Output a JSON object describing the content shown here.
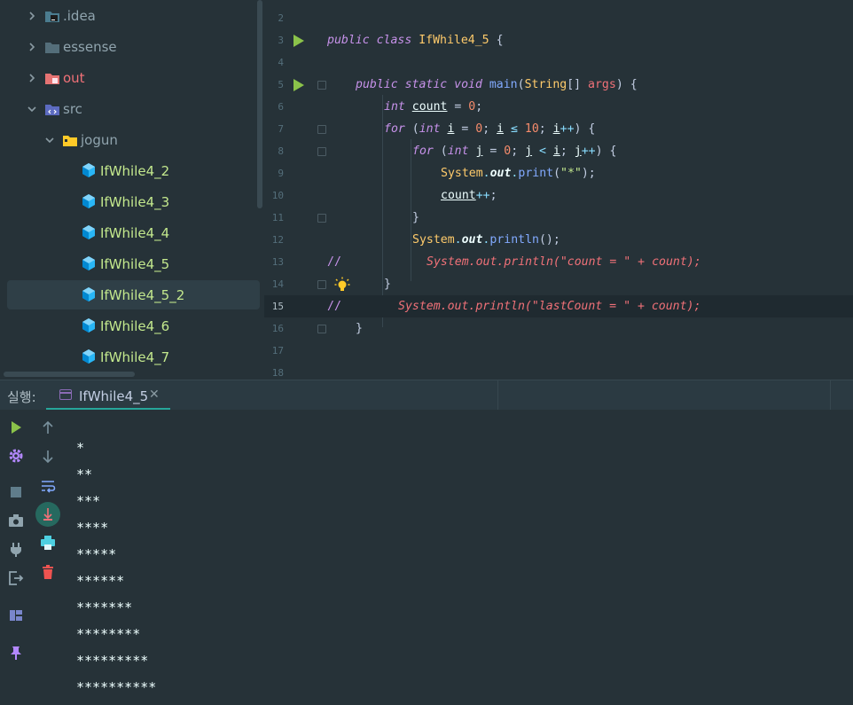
{
  "project_tree": {
    "items": [
      {
        "label": ".idea",
        "icon": "folder-idea-icon",
        "expanded": false
      },
      {
        "label": "essense",
        "icon": "folder-icon",
        "expanded": false
      },
      {
        "label": "out",
        "icon": "folder-out-icon",
        "expanded": false
      },
      {
        "label": "src",
        "icon": "folder-source-icon",
        "expanded": true
      },
      {
        "label": "jogun",
        "icon": "package-folder-icon",
        "expanded": true
      },
      {
        "label": "IfWhile4_2",
        "icon": "java-class-icon"
      },
      {
        "label": "IfWhile4_3",
        "icon": "java-class-icon"
      },
      {
        "label": "IfWhile4_4",
        "icon": "java-class-icon"
      },
      {
        "label": "IfWhile4_5",
        "icon": "java-class-icon"
      },
      {
        "label": "IfWhile4_5_2",
        "icon": "java-class-icon",
        "selected": true
      },
      {
        "label": "IfWhile4_6",
        "icon": "java-class-icon"
      },
      {
        "label": "IfWhile4_7",
        "icon": "java-class-icon"
      }
    ]
  },
  "editor": {
    "line_numbers": [
      "2",
      "3",
      "4",
      "5",
      "6",
      "7",
      "8",
      "9",
      "10",
      "11",
      "12",
      "13",
      "14",
      "15",
      "16",
      "17",
      "18"
    ],
    "current_line": "15",
    "code": {
      "l3_kw": "public class ",
      "l3_cls": "IfWhile4_5",
      "l3_rest": " {",
      "l5_kw": "public static void ",
      "l5_fn": "main",
      "l5_p1": "(",
      "l5_cls": "String",
      "l5_p2": "[] ",
      "l5_param": "args",
      "l5_p3": ") {",
      "l6_kw": "int ",
      "l6_var": "count",
      "l6_p1": " = ",
      "l6_num": "0",
      "l6_p2": ";",
      "l7_kw": "for ",
      "l7_p1": "(",
      "l7_kw2": "int ",
      "l7_var1": "i",
      "l7_p2": " = ",
      "l7_num1": "0",
      "l7_p3": "; ",
      "l7_var2": "i",
      "l7_op": " ≤ ",
      "l7_num2": "10",
      "l7_p4": "; ",
      "l7_var3": "i",
      "l7_inc": "++",
      "l7_p5": ") {",
      "l8_kw": "for ",
      "l8_p1": "(",
      "l8_kw2": "int ",
      "l8_var1": "j",
      "l8_p2": " = ",
      "l8_num1": "0",
      "l8_p3": "; ",
      "l8_var2": "j",
      "l8_op": " < ",
      "l8_var3": "i",
      "l8_p4": "; ",
      "l8_var4": "j",
      "l8_inc": "++",
      "l8_p5": ") {",
      "l9_cls": "System",
      "l9_dot1": ".",
      "l9_field": "out",
      "l9_dot2": ".",
      "l9_fn": "print",
      "l9_p1": "(",
      "l9_str": "\"*\"",
      "l9_p2": ");",
      "l10_var": "count",
      "l10_inc": "++",
      "l10_p": ";",
      "l11": "}",
      "l12_cls": "System",
      "l12_dot1": ".",
      "l12_field": "out",
      "l12_dot2": ".",
      "l12_fn": "println",
      "l12_p": "();",
      "l13_slashes": "//",
      "l13_cmt": "System.out.println(\"count = \" + count);",
      "l14": "}",
      "l15_slashes": "//",
      "l15_cmt": "System.out.println(\"lastCount = \" + count);",
      "l16": "}"
    }
  },
  "run_panel": {
    "title": "실행:",
    "tab_label": "IfWhile4_5",
    "tab_close": "✕",
    "output": [
      "*",
      "**",
      "***",
      "****",
      "*****",
      "******",
      "*******",
      "********",
      "*********",
      "**********"
    ]
  },
  "colors": {
    "background": "#263238",
    "accent": "#26a69a",
    "class_file": "#c3e88d",
    "run_green": "#8bc34a"
  }
}
